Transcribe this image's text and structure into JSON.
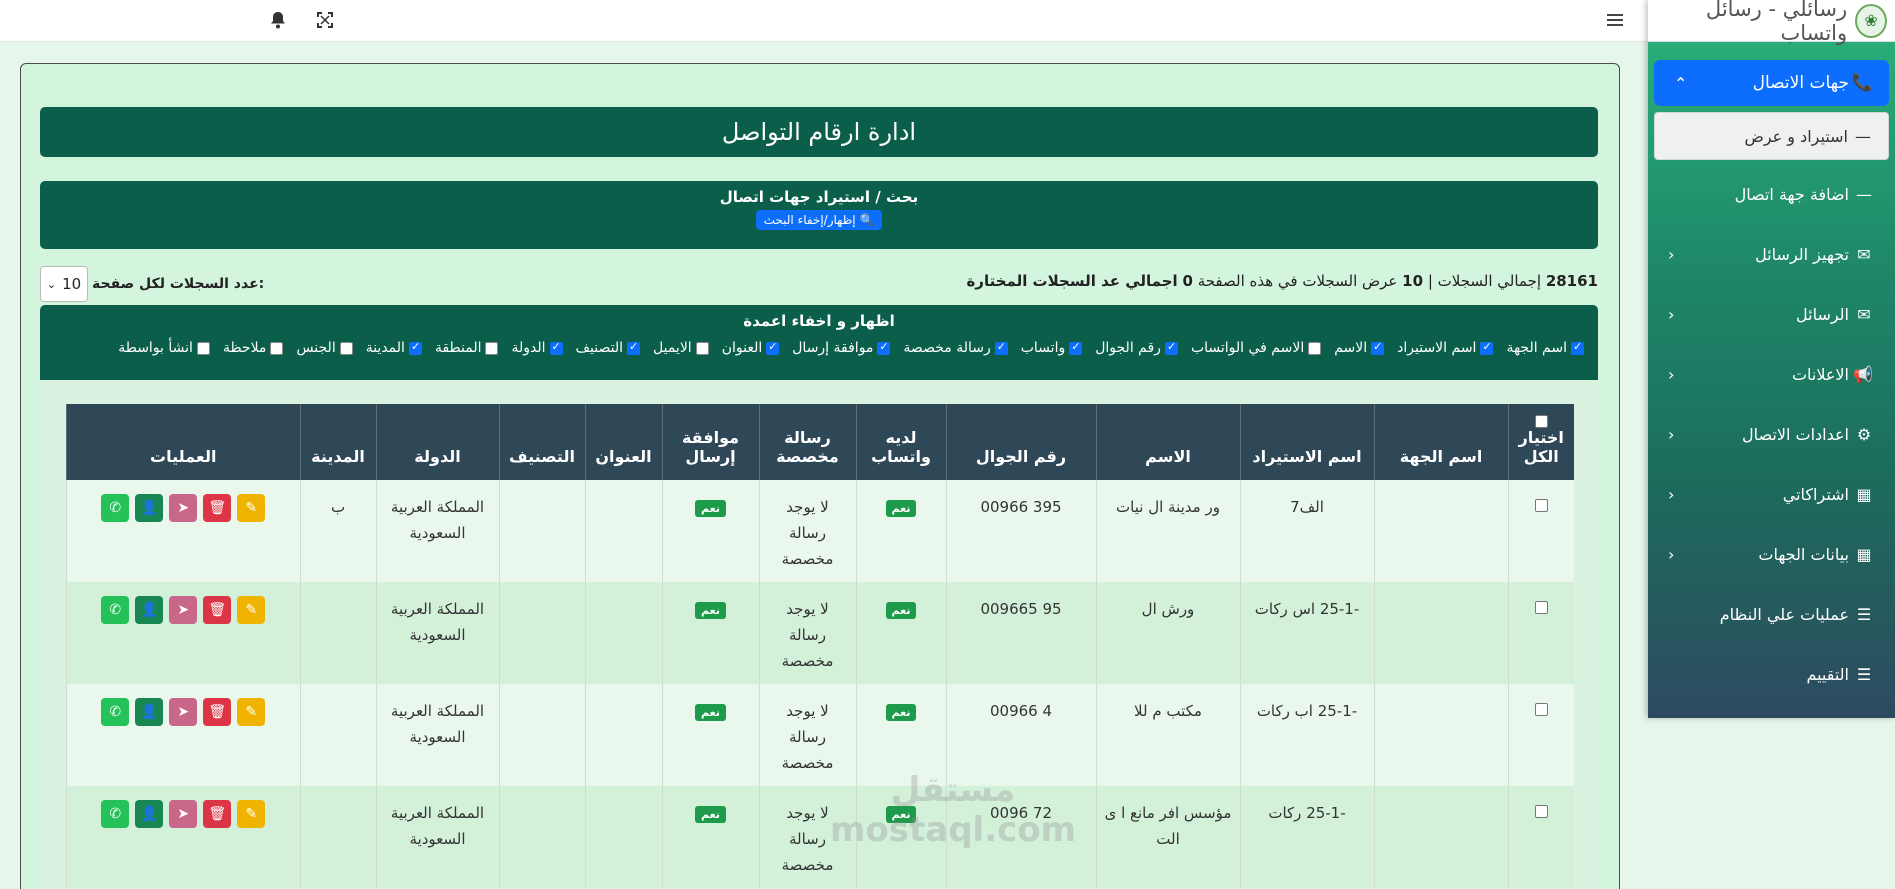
{
  "sidebar": {
    "brand": "رسائلي - رسائل واتساب",
    "items": [
      {
        "label": "جهات الاتصال",
        "icon": "phone-icon"
      },
      {
        "label": "استيراد و عرض"
      },
      {
        "label": "اضافة جهة اتصال"
      },
      {
        "label": "تجهيز الرسائل",
        "icon": "envelope-icon"
      },
      {
        "label": "الرسائل",
        "icon": "envelope-icon"
      },
      {
        "label": "الاعلانات",
        "icon": "bullhorn-icon"
      },
      {
        "label": "اعدادات الاتصال",
        "icon": "gear-icon"
      },
      {
        "label": "اشتراكاتي",
        "icon": "building-icon"
      },
      {
        "label": "بيانات الجهات",
        "icon": "building-icon"
      },
      {
        "label": "عمليات علي النظام",
        "icon": "list-icon"
      },
      {
        "label": "التقييم",
        "icon": "list-icon"
      }
    ]
  },
  "page": {
    "title": "ادارة ارقام التواصل",
    "search_title": "بحث / استيراد جهات اتصال",
    "search_button": "إظهار/إخفاء البحث"
  },
  "stats": {
    "total": "28161",
    "total_label": "إجمالي السجلات |",
    "shown": "10",
    "shown_label": "عرض السجلات في هذه الصفحة",
    "selected": "0",
    "selected_label": "اجمالي عد السجلات المختارة"
  },
  "per_page": {
    "label": "عدد السجلات لكل صفحة:",
    "value": "10"
  },
  "columns_toggle": {
    "title": "اظهار و اخفاء اعمدة",
    "items": [
      {
        "label": "اسم الجهة",
        "checked": true
      },
      {
        "label": "اسم الاستيراد",
        "checked": true
      },
      {
        "label": "الاسم",
        "checked": true
      },
      {
        "label": "الاسم في الواتساب",
        "checked": false
      },
      {
        "label": "رقم الجوال",
        "checked": true
      },
      {
        "label": "واتساب",
        "checked": true
      },
      {
        "label": "رسالة مخصصة",
        "checked": true
      },
      {
        "label": "موافقة إرسال",
        "checked": true
      },
      {
        "label": "العنوان",
        "checked": true
      },
      {
        "label": "الايميل",
        "checked": false
      },
      {
        "label": "التصنيف",
        "checked": true
      },
      {
        "label": "الدولة",
        "checked": true
      },
      {
        "label": "المنطقة",
        "checked": false
      },
      {
        "label": "المدينة",
        "checked": true
      },
      {
        "label": "الجنس",
        "checked": false
      },
      {
        "label": "ملاحظة",
        "checked": false
      },
      {
        "label": "انشأ بواسطة",
        "checked": false
      }
    ]
  },
  "table": {
    "headers": {
      "select_all": "اختيار الكل",
      "org": "اسم الجهة",
      "import": "اسم الاستيراد",
      "name": "الاسم",
      "mobile": "رقم الجوال",
      "whatsapp": "لديه واتساب",
      "custom_msg": "رسالة مخصصة",
      "consent": "موافقة إرسال",
      "address": "العنوان",
      "category": "التصنيف",
      "country": "الدولة",
      "city": "المدينة",
      "actions": "العمليات"
    },
    "rows": [
      {
        "org": "",
        "import": "الف7",
        "name": "ور مدينة ال نيات",
        "mobile": "00966 395",
        "whatsapp": "نعم",
        "custom_msg": "لا يوجد رسالة مخصصة",
        "consent": "نعم",
        "country": "المملكة العربية السعودية",
        "city": "ب"
      },
      {
        "org": "",
        "import": "-25-1 اس ركات",
        "name": "ورش ال",
        "mobile": "009665 95",
        "whatsapp": "نعم",
        "custom_msg": "لا يوجد رسالة مخصصة",
        "consent": "نعم",
        "country": "المملكة العربية السعودية",
        "city": ""
      },
      {
        "org": "",
        "import": "-25-1 اب ركات",
        "name": "مكتب م للا",
        "mobile": "00966 4",
        "whatsapp": "نعم",
        "custom_msg": "لا يوجد رسالة مخصصة",
        "consent": "نعم",
        "country": "المملكة العربية السعودية",
        "city": ""
      },
      {
        "org": "",
        "import": "-25-1 ركات",
        "name": "مؤسس افر مانع ا ى الت",
        "mobile": "0096 72",
        "whatsapp": "نعم",
        "custom_msg": "لا يوجد رسالة مخصصة",
        "consent": "نعم",
        "country": "المملكة العربية السعودية",
        "city": ""
      }
    ]
  },
  "watermark": {
    "line1": "مستقل",
    "line2": "mostaql.com"
  },
  "colors": {
    "primary_dark": "#0b5e4a",
    "accent_blue": "#0d6efd",
    "header_dark": "#2f4858",
    "badge_green": "#1e9a4b"
  }
}
